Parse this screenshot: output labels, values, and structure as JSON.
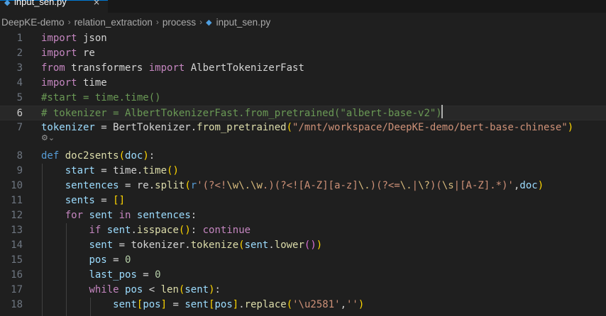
{
  "tab": {
    "label": "input_sen.py",
    "icon": "python-file-icon",
    "close": "×"
  },
  "breadcrumb": {
    "items": [
      "DeepKE-demo",
      "relation_extraction",
      "process",
      "input_sen.py"
    ],
    "separator": "›"
  },
  "editor": {
    "language": "python",
    "active_line": 6,
    "codelens_glyph": "⚙⌄",
    "lines": [
      {
        "n": "1",
        "tokens": [
          [
            "kw",
            "import"
          ],
          [
            "pl",
            " json"
          ]
        ]
      },
      {
        "n": "2",
        "tokens": [
          [
            "kw",
            "import"
          ],
          [
            "pl",
            " re"
          ]
        ]
      },
      {
        "n": "3",
        "tokens": [
          [
            "kw",
            "from"
          ],
          [
            "pl",
            " transformers "
          ],
          [
            "kw",
            "import"
          ],
          [
            "pl",
            " AlbertTokenizerFast"
          ]
        ]
      },
      {
        "n": "4",
        "tokens": [
          [
            "kw",
            "import"
          ],
          [
            "pl",
            " time"
          ]
        ]
      },
      {
        "n": "5",
        "tokens": [
          [
            "cm",
            "#start = time.time()"
          ]
        ]
      },
      {
        "n": "6",
        "tokens": [
          [
            "cm",
            "# tokenizer = AlbertTokenizerFast.from_pretrained(\"albert-base-v2\")"
          ]
        ]
      },
      {
        "n": "7",
        "tokens": [
          [
            "var",
            "tokenizer"
          ],
          [
            "pl",
            " = BertTokenizer."
          ],
          [
            "fn",
            "from_pretrained"
          ],
          [
            "br1",
            "("
          ],
          [
            "str",
            "\"/mnt/workspace/DeepKE-demo/bert-base-chinese\""
          ],
          [
            "br1",
            ")"
          ]
        ]
      },
      {
        "n": "",
        "tokens": []
      },
      {
        "n": "8",
        "tokens": [
          [
            "df",
            "def"
          ],
          [
            "pl",
            " "
          ],
          [
            "fn",
            "doc2sents"
          ],
          [
            "br1",
            "("
          ],
          [
            "var",
            "doc"
          ],
          [
            "br1",
            ")"
          ],
          [
            "pl",
            ":"
          ]
        ]
      },
      {
        "n": "9",
        "tokens": [
          [
            "pl",
            "    "
          ],
          [
            "var",
            "start"
          ],
          [
            "pl",
            " = time."
          ],
          [
            "fn",
            "time"
          ],
          [
            "br1",
            "()"
          ]
        ]
      },
      {
        "n": "10",
        "tokens": [
          [
            "pl",
            "    "
          ],
          [
            "var",
            "sentences"
          ],
          [
            "pl",
            " = re."
          ],
          [
            "fn",
            "split"
          ],
          [
            "br1",
            "("
          ],
          [
            "df",
            "r"
          ],
          [
            "str",
            "'(?<!"
          ],
          [
            "esc",
            "\\w\\.\\w"
          ],
          [
            "str",
            ".)(?<![A-Z][a-z]"
          ],
          [
            "esc",
            "\\."
          ],
          [
            "str",
            ")(?<="
          ],
          [
            "esc",
            "\\."
          ],
          [
            "str",
            "|"
          ],
          [
            "esc",
            "\\?"
          ],
          [
            "str",
            ")("
          ],
          [
            "esc",
            "\\s"
          ],
          [
            "str",
            "|[A-Z].*)'"
          ],
          [
            "pl",
            ","
          ],
          [
            "var",
            "doc"
          ],
          [
            "br1",
            ")"
          ]
        ]
      },
      {
        "n": "11",
        "tokens": [
          [
            "pl",
            "    "
          ],
          [
            "var",
            "sents"
          ],
          [
            "pl",
            " = "
          ],
          [
            "br1",
            "[]"
          ]
        ]
      },
      {
        "n": "12",
        "tokens": [
          [
            "pl",
            "    "
          ],
          [
            "kw",
            "for"
          ],
          [
            "pl",
            " "
          ],
          [
            "var",
            "sent"
          ],
          [
            "pl",
            " "
          ],
          [
            "kw",
            "in"
          ],
          [
            "pl",
            " "
          ],
          [
            "var",
            "sentences"
          ],
          [
            "pl",
            ":"
          ]
        ]
      },
      {
        "n": "13",
        "tokens": [
          [
            "pl",
            "        "
          ],
          [
            "kw",
            "if"
          ],
          [
            "pl",
            " "
          ],
          [
            "var",
            "sent"
          ],
          [
            "pl",
            "."
          ],
          [
            "fn",
            "isspace"
          ],
          [
            "br1",
            "()"
          ],
          [
            "pl",
            ": "
          ],
          [
            "kw",
            "continue"
          ]
        ]
      },
      {
        "n": "14",
        "tokens": [
          [
            "pl",
            "        "
          ],
          [
            "var",
            "sent"
          ],
          [
            "pl",
            " = tokenizer."
          ],
          [
            "fn",
            "tokenize"
          ],
          [
            "br1",
            "("
          ],
          [
            "var",
            "sent"
          ],
          [
            "pl",
            "."
          ],
          [
            "fn",
            "lower"
          ],
          [
            "br2",
            "()"
          ],
          [
            "br1",
            ")"
          ]
        ]
      },
      {
        "n": "15",
        "tokens": [
          [
            "pl",
            "        "
          ],
          [
            "var",
            "pos"
          ],
          [
            "pl",
            " = "
          ],
          [
            "num",
            "0"
          ]
        ]
      },
      {
        "n": "16",
        "tokens": [
          [
            "pl",
            "        "
          ],
          [
            "var",
            "last_pos"
          ],
          [
            "pl",
            " = "
          ],
          [
            "num",
            "0"
          ]
        ]
      },
      {
        "n": "17",
        "tokens": [
          [
            "pl",
            "        "
          ],
          [
            "kw",
            "while"
          ],
          [
            "pl",
            " "
          ],
          [
            "var",
            "pos"
          ],
          [
            "pl",
            " < "
          ],
          [
            "fn",
            "len"
          ],
          [
            "br1",
            "("
          ],
          [
            "var",
            "sent"
          ],
          [
            "br1",
            ")"
          ],
          [
            "pl",
            ":"
          ]
        ]
      },
      {
        "n": "18",
        "tokens": [
          [
            "pl",
            "            "
          ],
          [
            "var",
            "sent"
          ],
          [
            "br1",
            "["
          ],
          [
            "var",
            "pos"
          ],
          [
            "br1",
            "]"
          ],
          [
            "pl",
            " = "
          ],
          [
            "var",
            "sent"
          ],
          [
            "br1",
            "["
          ],
          [
            "var",
            "pos"
          ],
          [
            "br1",
            "]"
          ],
          [
            "pl",
            "."
          ],
          [
            "fn",
            "replace"
          ],
          [
            "br1",
            "("
          ],
          [
            "str",
            "'\\u2581'"
          ],
          [
            "pl",
            ","
          ],
          [
            "str",
            "''"
          ],
          [
            "br1",
            ")"
          ]
        ]
      }
    ]
  }
}
